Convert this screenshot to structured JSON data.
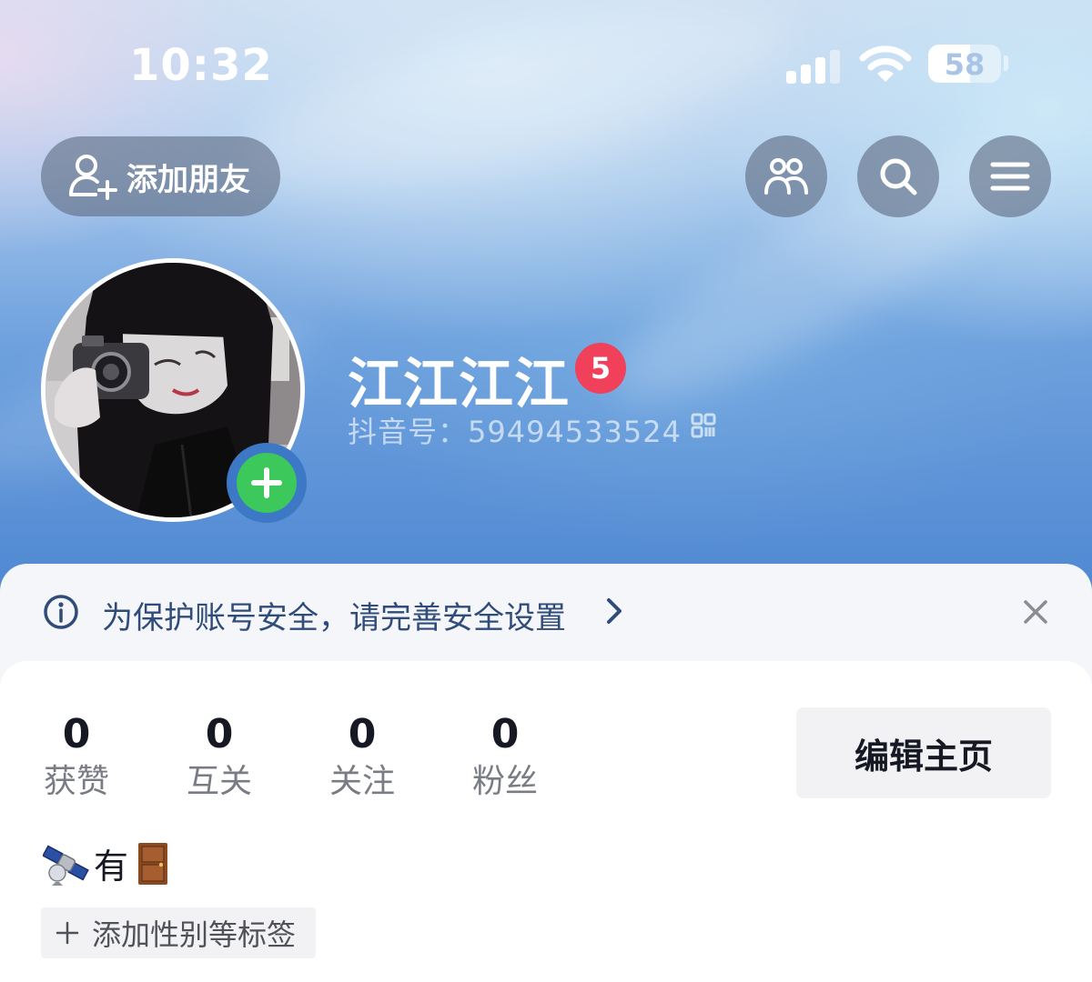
{
  "status_bar": {
    "time": "10:32",
    "battery_percent": "58",
    "battery_level": 0.58
  },
  "header": {
    "add_friend_label": "添加朋友",
    "icons": [
      "friends-icon",
      "search-icon",
      "menu-icon"
    ]
  },
  "profile": {
    "nickname": "江江江江",
    "level_badge": "5",
    "account_id": "抖音号：59494533524",
    "avatar_description_icon": "avatar-image"
  },
  "notice": {
    "text": "为保护账号安全，请完善安全设置",
    "icon": "info-icon"
  },
  "stats": [
    {
      "value": "0",
      "label": "获赞"
    },
    {
      "value": "0",
      "label": "互关"
    },
    {
      "value": "0",
      "label": "关注"
    },
    {
      "value": "0",
      "label": "粉丝"
    }
  ],
  "edit_button_label": "编辑主页",
  "bio": {
    "emoji_before": "satellite-emoji",
    "word": "有",
    "emoji_after": "door-emoji"
  },
  "add_tags_label": "添加性别等标签",
  "colors": {
    "accent_green": "#3cc85a",
    "badge_red": "#f0405a",
    "notice_text": "#2f4c7a"
  }
}
